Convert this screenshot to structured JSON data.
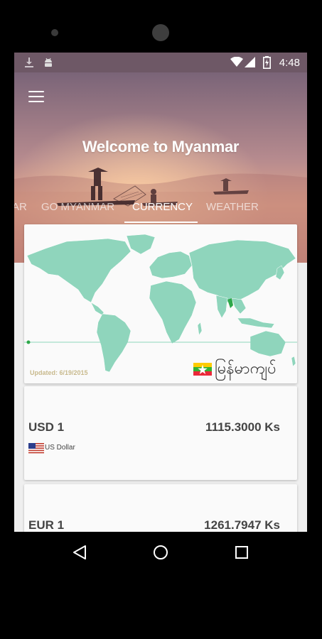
{
  "status_bar": {
    "time": "4:48",
    "left_icons": [
      "download-icon",
      "android-icon"
    ],
    "right_icons": [
      "wifi-icon",
      "signal-icon",
      "battery-charging-icon"
    ]
  },
  "header": {
    "title": "Welcome to Myanmar",
    "menu_icon": "menu-icon"
  },
  "tabs": [
    {
      "label": "AR",
      "active": false
    },
    {
      "label": "GO MYANMAR",
      "active": false
    },
    {
      "label": "CURRENCY",
      "active": true
    },
    {
      "label": "WEATHER",
      "active": false
    }
  ],
  "map_card": {
    "updated": "Updated: 6/19/2015",
    "country_name": "မြန်မာကျပ်",
    "flag_icon": "myanmar-flag-icon",
    "map_color": "#8fd5bc"
  },
  "rates": [
    {
      "code": "USD 1",
      "value": "1115.3000 Ks",
      "name": "US Dollar",
      "flag_icon": "us-flag-icon"
    },
    {
      "code": "EUR 1",
      "value": "1261.7947 Ks"
    }
  ],
  "nav": {
    "back_icon": "back-icon",
    "home_icon": "home-icon",
    "recents_icon": "recents-icon"
  },
  "colors": {
    "status_bar": "#6e5866",
    "hero_top": "#7a6478",
    "hero_bottom": "#e8a989",
    "map_land": "#8fd5bc",
    "card_bg": "#fafafa"
  }
}
